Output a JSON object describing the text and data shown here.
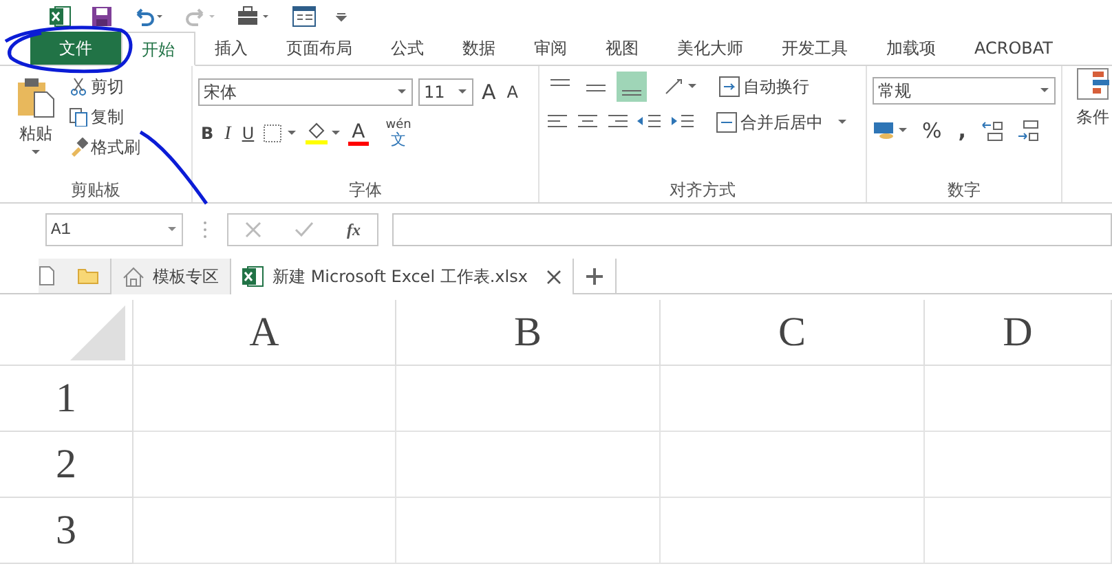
{
  "tabs": [
    {
      "label": "文件",
      "kind": "file",
      "selected": false
    },
    {
      "label": "开始",
      "kind": "tab",
      "selected": true
    },
    {
      "label": "插入",
      "kind": "tab",
      "selected": false
    },
    {
      "label": "页面布局",
      "kind": "tab",
      "selected": false
    },
    {
      "label": "公式",
      "kind": "tab",
      "selected": false
    },
    {
      "label": "数据",
      "kind": "tab",
      "selected": false
    },
    {
      "label": "审阅",
      "kind": "tab",
      "selected": false
    },
    {
      "label": "视图",
      "kind": "tab",
      "selected": false
    },
    {
      "label": "美化大师",
      "kind": "tab",
      "selected": false
    },
    {
      "label": "开发工具",
      "kind": "tab",
      "selected": false
    },
    {
      "label": "加载项",
      "kind": "tab",
      "selected": false
    },
    {
      "label": "ACROBAT",
      "kind": "tab",
      "selected": false
    }
  ],
  "clipboard": {
    "paste": "粘贴",
    "cut": "剪切",
    "copy": "复制",
    "format_painter": "格式刷",
    "title": "剪贴板"
  },
  "font": {
    "font_name": "宋体",
    "font_size": "11",
    "bold": "B",
    "italic": "I",
    "underline": "U",
    "phonetic_top": "wén",
    "phonetic_bottom": "文",
    "grow": "A",
    "shrink": "A",
    "font_color": "A",
    "title": "字体"
  },
  "alignment": {
    "buttons": [
      {
        "selected": false
      },
      {
        "selected": false
      },
      {
        "selected": true
      }
    ],
    "wrap": "自动换行",
    "merge": "合并后居中",
    "title": "对齐方式"
  },
  "number": {
    "format": "常规",
    "percent": "%",
    "comma": ",",
    "title": "数字"
  },
  "styles": {
    "conditional": "条件"
  },
  "formula_bar": {
    "name_box": "A1",
    "fx": "fx"
  },
  "doc_tabs": [
    {
      "label": "模板专区",
      "kind": "home",
      "selected": false
    },
    {
      "label": "新建 Microsoft Excel 工作表.xlsx",
      "kind": "excel",
      "selected": true
    }
  ],
  "sheet": {
    "columns": [
      "A",
      "B",
      "C",
      "D"
    ],
    "rows": [
      "1",
      "2",
      "3"
    ]
  }
}
